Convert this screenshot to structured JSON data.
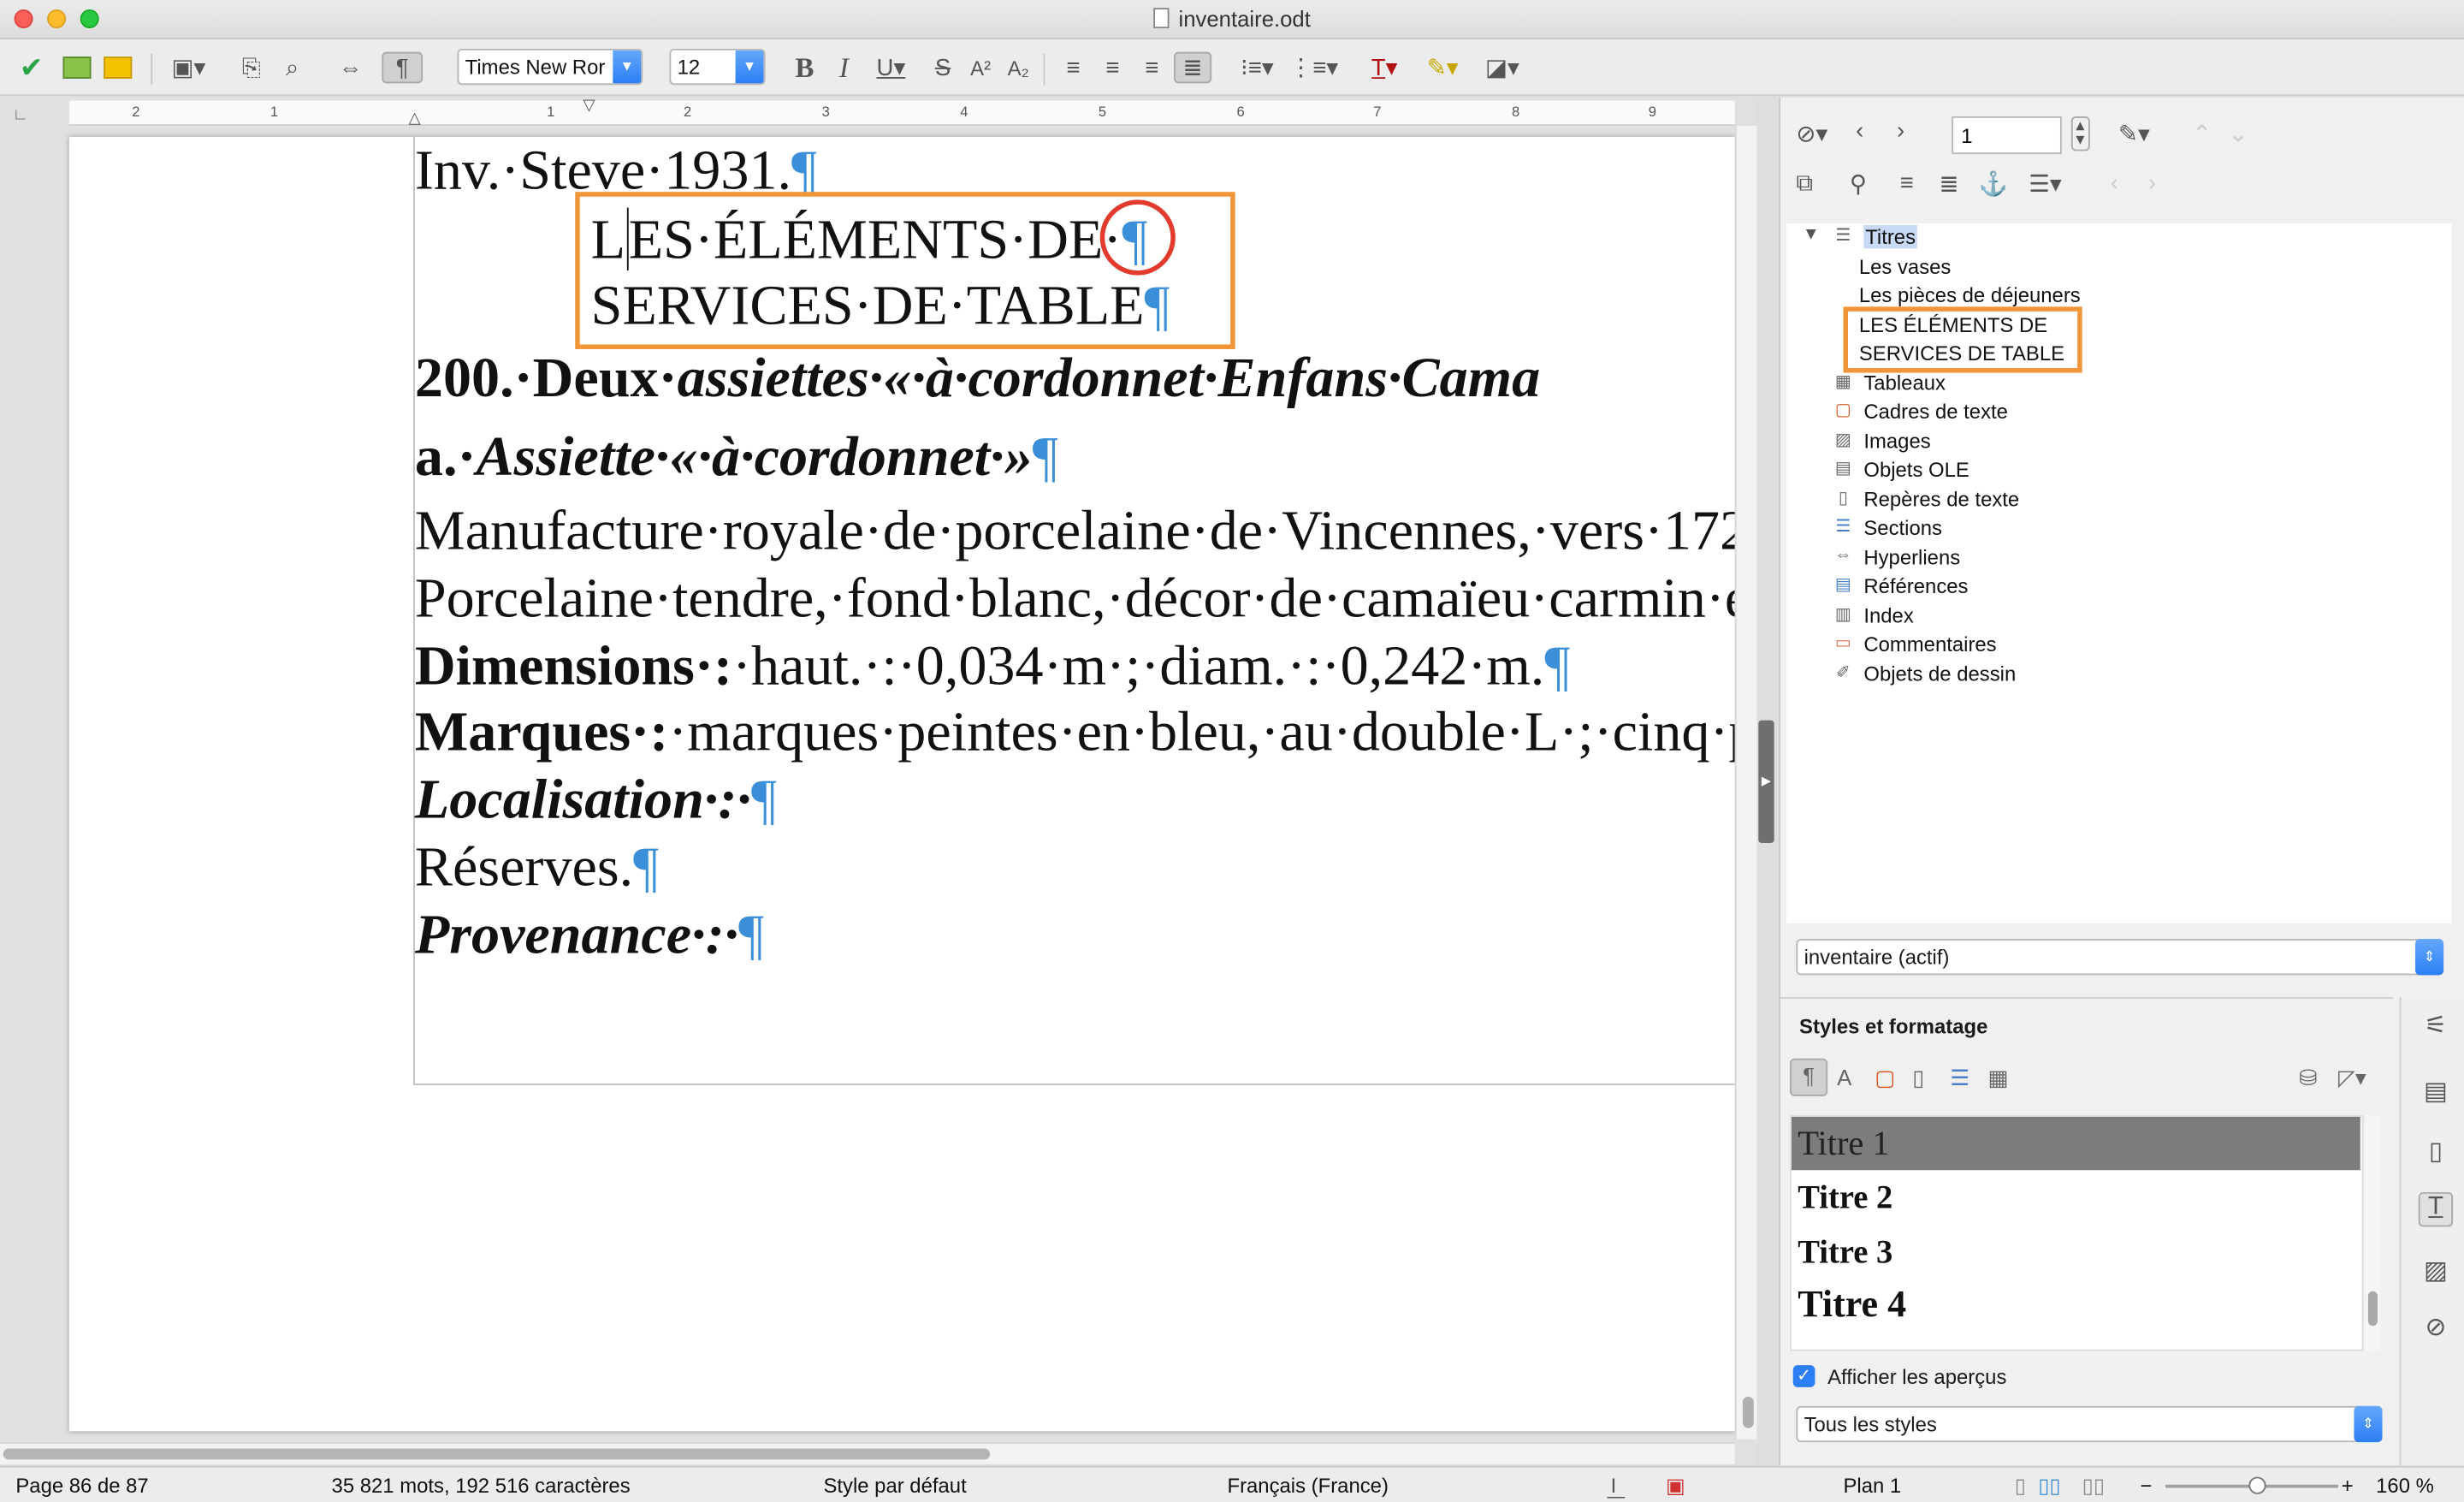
{
  "window": {
    "title": "inventaire.odt"
  },
  "toolbar": {
    "font_name": "Times New Ror",
    "font_size": "12"
  },
  "ruler": {
    "ticks": [
      "2",
      "1",
      "1",
      "2",
      "3",
      "4",
      "5",
      "6",
      "7",
      "8",
      "9"
    ]
  },
  "document": {
    "l1_text": "Inv.·Steve·1931.",
    "pilcrow": "¶",
    "l2_text": "L",
    "l2_rest": "ES·ÉLÉMENTS·DE·",
    "l3_text": "SERVICES·DE·TABLE",
    "l4_a": "200.·Deux·",
    "l4_b": "assiettes·«·à·cordonnet·Enfans·Cama",
    "l5_a": "a.·",
    "l5_b": "Assiette·«·à·cordonnet·»",
    "l6_text": "Manufacture·royale·de·porcelaine·de·Vincennes,·vers·172",
    "l7_text": "Porcelaine·tendre,·fond·blanc,·décor·de·camaïeu·carmin·e",
    "l8_a": "Dimensions·:",
    "l8_b": "·haut.·:·0,034·m·;·diam.·:·0,242·m.",
    "l9_a": "Marques·:",
    "l9_b": "·marques·peintes·en·bleu,·au·double·L·;·cinq·p",
    "l10_text": "Localisation·:·",
    "l11_text": "Réserves.",
    "l12_text": "Provenance·:·"
  },
  "navigator": {
    "page_number": "1",
    "titles_root": "Titres",
    "headings": [
      "Les vases",
      "Les pièces de déjeuners",
      "LES ÉLÉMENTS DE",
      "SERVICES DE TABLE"
    ],
    "categories": [
      "Tableaux",
      "Cadres de texte",
      "Images",
      "Objets OLE",
      "Repères de texte",
      "Sections",
      "Hyperliens",
      "Références",
      "Index",
      "Commentaires",
      "Objets de dessin"
    ],
    "document_select": "inventaire (actif)"
  },
  "styles": {
    "title": "Styles et formatage",
    "items": [
      "Titre 1",
      "Titre 2",
      "Titre 3",
      "Titre 4"
    ],
    "show_previews_label": "Afficher les aperçus",
    "show_previews_checked": true,
    "filter": "Tous les styles"
  },
  "status": {
    "page": "Page 86 de 87",
    "words": "35 821 mots, 192 516 caractères",
    "style": "Style par défaut",
    "language": "Français (France)",
    "outline": "Plan 1",
    "zoom": "160 %"
  },
  "colors": {
    "highlight_box": "#f0953a",
    "circle": "#e23b2e",
    "pilcrow": "#3a8fd8",
    "accent": "#2d7ff5"
  }
}
